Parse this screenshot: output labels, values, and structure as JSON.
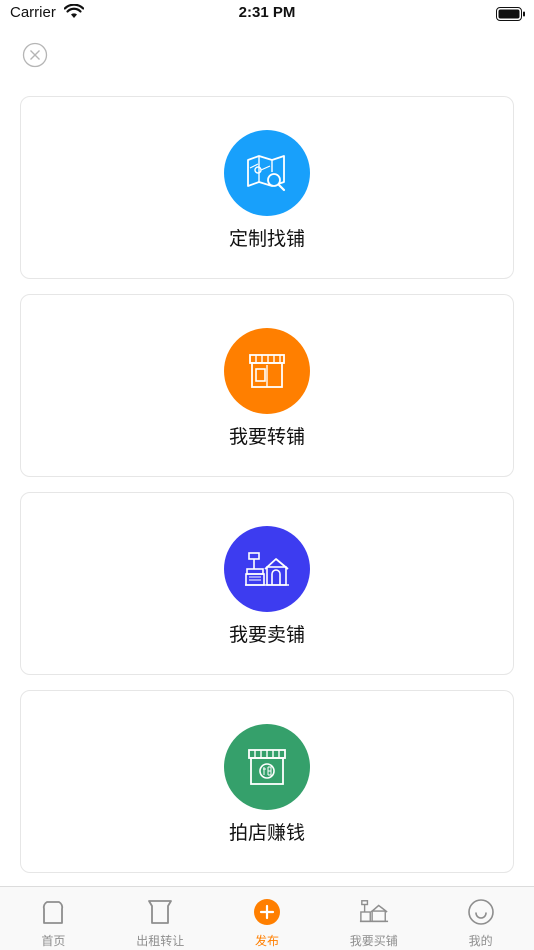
{
  "status_bar": {
    "carrier": "Carrier",
    "time": "2:31 PM"
  },
  "cards": [
    {
      "label": "定制找铺",
      "icon": "map-search-icon",
      "color": "#18a0fb"
    },
    {
      "label": "我要转铺",
      "icon": "storefront-icon",
      "color": "#ff7f00"
    },
    {
      "label": "我要卖铺",
      "icon": "shop-building-icon",
      "color": "#3d3cf0"
    },
    {
      "label": "拍店赚钱",
      "icon": "auction-store-icon",
      "color": "#35a06b"
    }
  ],
  "tab_bar": {
    "items": [
      {
        "label": "首页",
        "icon": "home-bread-icon"
      },
      {
        "label": "出租转让",
        "icon": "rent-transfer-icon"
      },
      {
        "label": "发布",
        "icon": "publish-plus-icon",
        "active": true
      },
      {
        "label": "我要买铺",
        "icon": "buy-shop-icon"
      },
      {
        "label": "我的",
        "icon": "profile-smile-icon"
      }
    ]
  },
  "colors": {
    "accent": "#ff7f00",
    "tab_inactive": "#8e8e8e",
    "card_border": "#e6e6e6"
  }
}
